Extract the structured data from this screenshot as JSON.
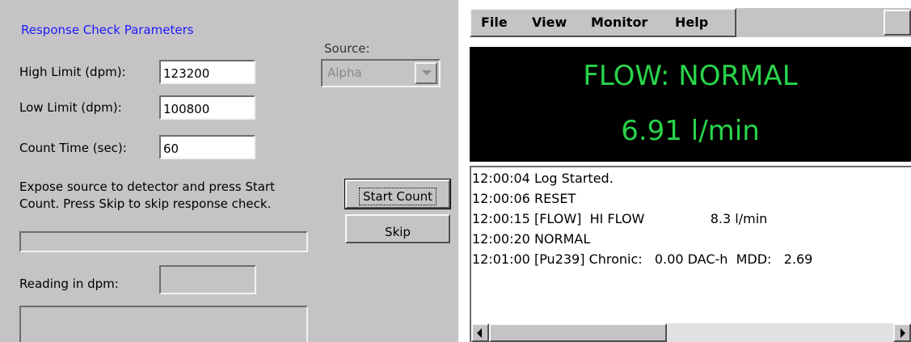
{
  "response_check": {
    "group_title": "Response Check Parameters",
    "high_limit_label": "High Limit (dpm):",
    "high_limit_value": "123200",
    "low_limit_label": "Low Limit (dpm):",
    "low_limit_value": "100800",
    "count_time_label": "Count Time (sec):",
    "count_time_value": "60",
    "source_label": "Source:",
    "source_value": "Alpha",
    "instructions_line1": "Expose source to detector and press Start",
    "instructions_line2": "Count.  Press Skip to skip response check.",
    "start_count_label": "Start Count",
    "skip_label": "Skip",
    "progress": 0,
    "reading_label": "Reading in dpm:",
    "reading_value": "",
    "status_message": ""
  },
  "monitor": {
    "menu": [
      "File",
      "View",
      "Monitor",
      "Help"
    ],
    "status_text": "FLOW: NORMAL",
    "flow_rate": "6.91 l/min",
    "display_text_color": "#28d44a",
    "display_background": "#000000",
    "log": [
      "12:00:04 Log Started.",
      "12:00:06 RESET",
      "12:00:15 [FLOW]  HI FLOW                8.3 l/min",
      "12:00:20 NORMAL",
      "12:01:00 [Pu239] Chronic:   0.00 DAC-h  MDD:   2.69"
    ]
  }
}
